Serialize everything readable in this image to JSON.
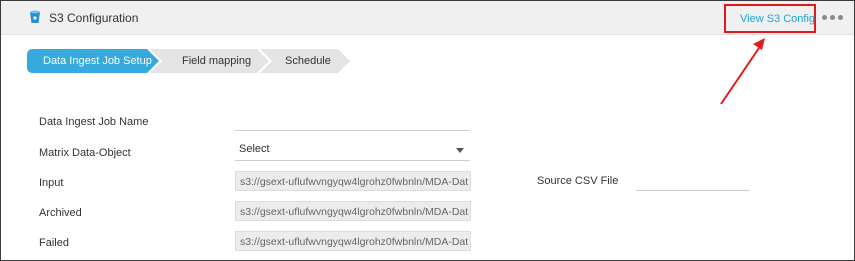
{
  "header": {
    "title": "S3 Configuration",
    "view_config_label": "View S3 Config",
    "bucket_icon": "bucket-icon",
    "more_icon": "more-horizontal-icon"
  },
  "steps": [
    {
      "label": "Data Ingest Job Setup",
      "active": true
    },
    {
      "label": "Field mapping",
      "active": false
    },
    {
      "label": "Schedule",
      "active": false
    }
  ],
  "form": {
    "job_name_label": "Data Ingest Job Name",
    "job_name_value": "",
    "matrix_label": "Matrix Data-Object",
    "matrix_value": "Select",
    "input_label": "Input",
    "input_value": "s3://gsext-uflufwvngyqw4lgrohz0fwbnln/MDA-Dat",
    "archived_label": "Archived",
    "archived_value": "s3://gsext-uflufwvngyqw4lgrohz0fwbnln/MDA-Dat",
    "failed_label": "Failed",
    "failed_value": "s3://gsext-uflufwvngyqw4lgrohz0fwbnln/MDA-Dat",
    "source_csv_label": "Source CSV File",
    "source_csv_value": ""
  },
  "colors": {
    "accent": "#1fa5dc",
    "step_active_bg": "#36a9dd",
    "step_inactive_bg": "#e4e4e4",
    "annotation_red": "#e21a1a"
  }
}
